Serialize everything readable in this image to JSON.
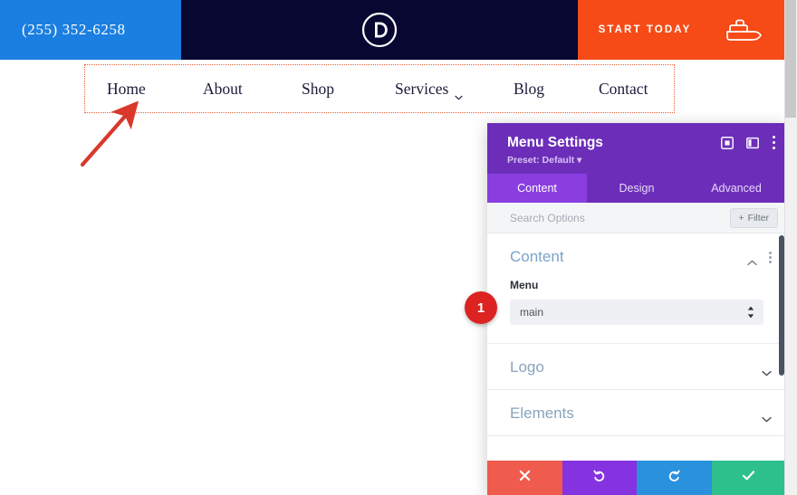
{
  "site_header": {
    "phone": "(255) 352-6258",
    "logo_icon": "divi-d-logo-icon",
    "logo_letter": "D",
    "cta_label": "START TODAY",
    "cta_icon": "boat-icon",
    "colors": {
      "phone_bar": "#1a7fe0",
      "logo_bar": "#070731",
      "cta_bar": "#f64b16"
    }
  },
  "nav": {
    "items": [
      {
        "label": "Home",
        "has_dropdown": false
      },
      {
        "label": "About",
        "has_dropdown": false
      },
      {
        "label": "Shop",
        "has_dropdown": false
      },
      {
        "label": "Services",
        "has_dropdown": true
      },
      {
        "label": "Blog",
        "has_dropdown": false
      },
      {
        "label": "Contact",
        "has_dropdown": false
      }
    ],
    "selection_border_color": "#e8603c"
  },
  "annotation": {
    "arrow_color": "#d9382b",
    "step_badge": "1",
    "badge_color": "#dd2222"
  },
  "modal": {
    "title": "Menu Settings",
    "preset": "Preset: Default",
    "header_color": "#6c2eb9",
    "header_icons": [
      {
        "name": "expand-icon"
      },
      {
        "name": "panel-layout-icon"
      },
      {
        "name": "more-options-icon"
      }
    ],
    "tabs": [
      {
        "label": "Content",
        "active": true
      },
      {
        "label": "Design",
        "active": false
      },
      {
        "label": "Advanced",
        "active": false
      }
    ],
    "search": {
      "placeholder": "Search Options",
      "value": ""
    },
    "filter_button": {
      "label": "Filter",
      "icon": "plus-icon"
    },
    "sections": [
      {
        "title": "Content",
        "expanded": true,
        "chevron": "chevron-up-icon",
        "fields": [
          {
            "label": "Menu",
            "type": "select",
            "value": "main",
            "options": [
              "main"
            ]
          }
        ]
      },
      {
        "title": "Logo",
        "expanded": false,
        "chevron": "chevron-down-icon",
        "fields": []
      },
      {
        "title": "Elements",
        "expanded": false,
        "chevron": "chevron-down-icon",
        "fields": []
      }
    ],
    "footer_buttons": [
      {
        "name": "cancel-button",
        "icon": "close-x-icon",
        "color": "#ef5b4c"
      },
      {
        "name": "undo-button",
        "icon": "undo-arrow-icon",
        "color": "#8532e0"
      },
      {
        "name": "redo-button",
        "icon": "redo-arrow-icon",
        "color": "#2a91dd"
      },
      {
        "name": "save-button",
        "icon": "checkmark-icon",
        "color": "#2dc08d"
      }
    ]
  }
}
